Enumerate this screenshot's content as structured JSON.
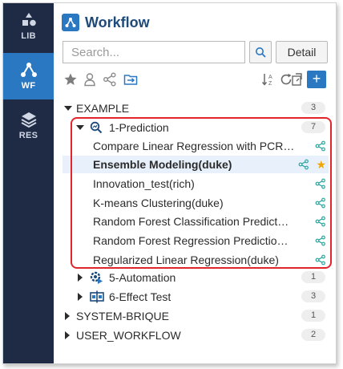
{
  "rail": {
    "items": [
      {
        "label": "LIB",
        "icon": "library-shapes-icon",
        "active": false
      },
      {
        "label": "WF",
        "icon": "workflow-icon",
        "active": true
      },
      {
        "label": "RES",
        "icon": "layers-icon",
        "active": false
      }
    ]
  },
  "header": {
    "title": "Workflow",
    "search_placeholder": "Search...",
    "detail_label": "Detail"
  },
  "toolbar": {
    "left_icons": [
      "star-icon",
      "user-icon",
      "share-icon",
      "folder-icon"
    ],
    "right_icons": [
      "sort-az-icon",
      "refresh-icon",
      "export-icon"
    ],
    "add_label": "+"
  },
  "tree": {
    "example": {
      "label": "EXAMPLE",
      "count": "3"
    },
    "prediction": {
      "label": "1-Prediction",
      "count": "7",
      "items": [
        {
          "label": "Compare Linear Regression with PCR…",
          "bold": false,
          "star": false
        },
        {
          "label": "Ensemble Modeling(duke)",
          "bold": true,
          "star": true
        },
        {
          "label": "Innovation_test(rich)",
          "bold": false,
          "star": false
        },
        {
          "label": "K-means Clustering(duke)",
          "bold": false,
          "star": false
        },
        {
          "label": "Random Forest Classification Predict…",
          "bold": false,
          "star": false
        },
        {
          "label": "Random Forest Regression Predictio…",
          "bold": false,
          "star": false
        },
        {
          "label": "Regularized Linear Regression(duke)",
          "bold": false,
          "star": false
        }
      ]
    },
    "automation": {
      "label": "5-Automation",
      "count": "1"
    },
    "effect_test": {
      "label": "6-Effect Test",
      "count": "3"
    },
    "system_brique": {
      "label": "SYSTEM-BRIQUE",
      "count": "1"
    },
    "user_workflow": {
      "label": "USER_WORKFLOW",
      "count": "2"
    }
  },
  "colors": {
    "rail_bg": "#1f2a44",
    "accent": "#2a78c2",
    "highlight": "#e2252b",
    "star": "#f0a500"
  }
}
